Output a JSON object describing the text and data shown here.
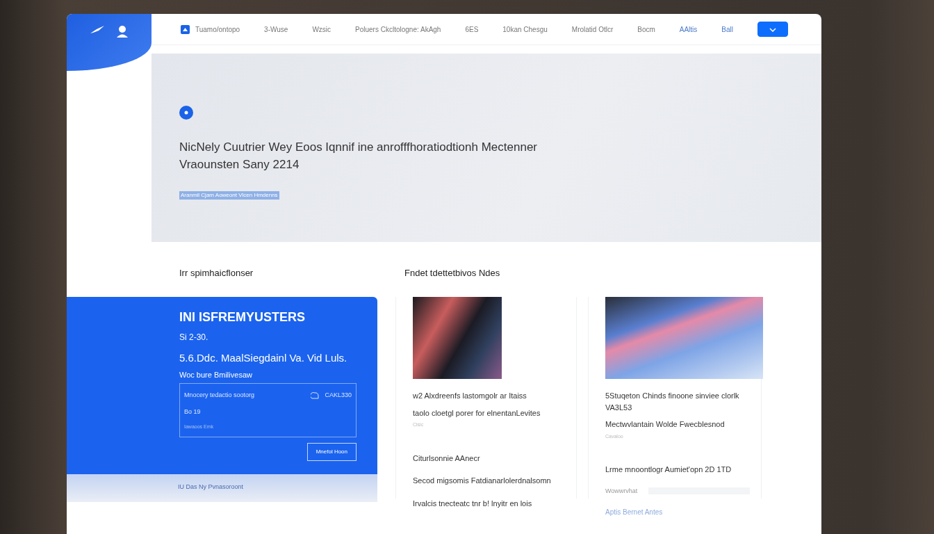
{
  "nav": {
    "items": [
      {
        "label": "Tuamo/ontopo",
        "kind": "icon"
      },
      {
        "label": "3-Wuse",
        "kind": "plain"
      },
      {
        "label": "Wzsic",
        "kind": "plain"
      },
      {
        "label": "Poluers Ckcltologne: AkAgh",
        "kind": "plain"
      },
      {
        "label": "6ES",
        "kind": "plain"
      },
      {
        "label": "10kan Chesgu",
        "kind": "plain"
      },
      {
        "label": "Mrolatid Otlcr",
        "kind": "plain"
      },
      {
        "label": "Bocm",
        "kind": "plain"
      },
      {
        "label": "AAltis",
        "kind": "accent"
      },
      {
        "label": "Ball",
        "kind": "accent"
      }
    ]
  },
  "hero": {
    "title": "NicNely Cuutrier Wey Eoos Iqnnif ine anrofffhoratiodtionh Mectenner Vraounsten Sany 2214",
    "link": "Aranmil Cjam Aoweont Vlcen Hmdenns"
  },
  "left_section": {
    "heading": "Irr spimhaicflonser",
    "title": "INI ISFREMYUSTERS",
    "date": "Si 2-30.",
    "subtitle": "5.6.Ddc. MaalSiegdainl Va. Vid Luls.",
    "caption": "Woc bure Bmilivesaw",
    "panel": {
      "text": "Mnocery tedactio sootorg",
      "code": "CAKL330",
      "value": "Bo 19",
      "note": "Iawaoos Emk"
    },
    "button": "Mnefol Hoon",
    "footer": "IU Das Ny Pvnasoroont"
  },
  "right_section": {
    "heading": "Fndet tdettetbivos Ndes",
    "cards": [
      {
        "title": "w2 Alxdreenfs lastomgolr ar Itaiss",
        "subtitle": "taolo cloetgl porer for elnentanLevites",
        "meta": "Cisic",
        "heading": "Citurlsonnie AAnecr",
        "lines": [
          "Secod migsomis Fatdianarlolerdnalsomn",
          "Irvalcis tnecteatc tnr b! lnyitr en lois"
        ],
        "kind": "text"
      },
      {
        "title": "5Stuqeton Chinds finoone sinviee clorlk VA3L53",
        "subtitle": "Mectwvlantain Wolde Fwecblesnod",
        "meta": "Cavaloo",
        "heading": "Lrme mnoontlogr Aumiet'opn 2D 1TD",
        "field_label": "Wowwrvhat",
        "link": "Aptis Bernet Antes",
        "kind": "form"
      }
    ]
  }
}
